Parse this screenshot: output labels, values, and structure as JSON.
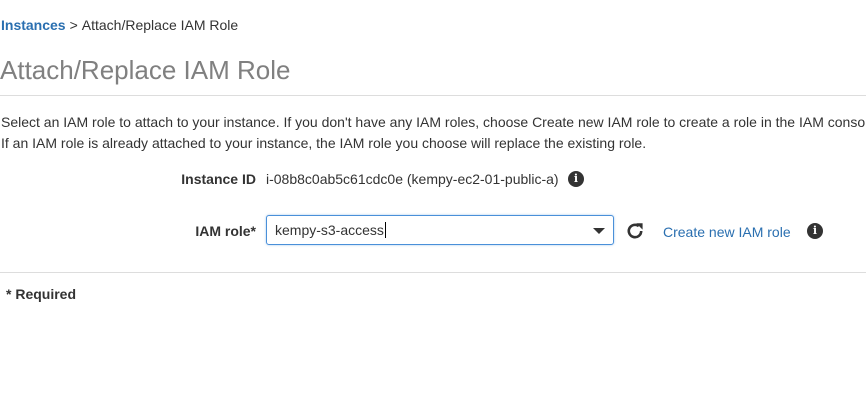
{
  "breadcrumb": {
    "link_label": "Instances",
    "separator": ">",
    "current": "Attach/Replace IAM Role"
  },
  "page": {
    "title": "Attach/Replace IAM Role",
    "description_line1": "Select an IAM role to attach to your instance. If you don't have any IAM roles, choose Create new IAM role to create a role in the IAM console.",
    "description_line2": "If an IAM role is already attached to your instance, the IAM role you choose will replace the existing role."
  },
  "form": {
    "instance_id_label": "Instance ID",
    "instance_id_value": "i-08b8c0ab5c61cdc0e (kempy-ec2-01-public-a)",
    "iam_role_label": "IAM role*",
    "iam_role_value": "kempy-s3-access",
    "create_link_label": "Create new IAM role",
    "info_icon_glyph": "i"
  },
  "footer": {
    "required_note": "* Required"
  },
  "colors": {
    "link": "#2a6fb0",
    "title": "#808080",
    "focus_border": "#4a90d9"
  },
  "icons": {
    "info": "info-icon",
    "refresh": "refresh-icon",
    "dropdown": "chevron-down-icon"
  }
}
